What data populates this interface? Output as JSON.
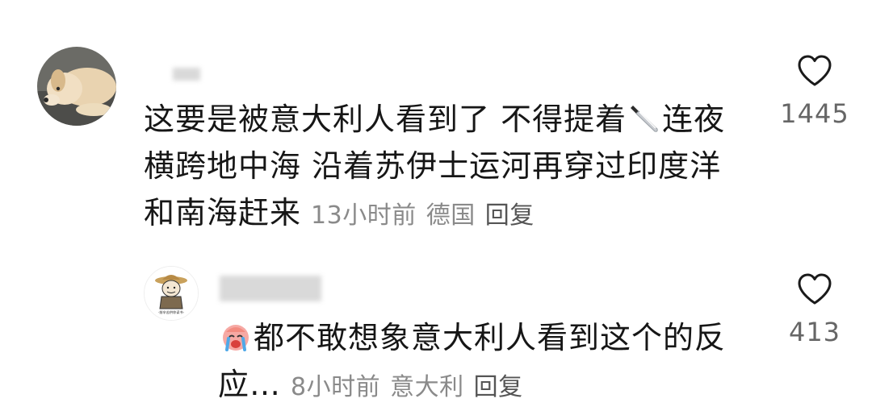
{
  "comments": [
    {
      "avatar": "golden-retriever-photo",
      "line1": "这要是被意大利人看到了 不得提着",
      "emoji": "knife-icon",
      "line1b": "连夜",
      "line2": "横跨地中海 沿着苏伊士运河再穿过印度洋",
      "line3": "和南海赶来",
      "time": "13小时前",
      "location": "德国",
      "reply": "回复",
      "likes": "1445"
    },
    {
      "avatar": "cartoon-farmer-avatar",
      "avatar_caption": "·前辛苦供你读书·每天在议·",
      "emoji": "crying-face-icon",
      "line1": "都不敢想象意大利人看到这个的反",
      "line2": "应…",
      "time": "8小时前",
      "location": "意大利",
      "reply": "回复",
      "likes": "413"
    }
  ],
  "colors": {
    "text": "#161616",
    "meta": "#8a8a8a",
    "reply": "#555555",
    "like_count": "#666666"
  }
}
